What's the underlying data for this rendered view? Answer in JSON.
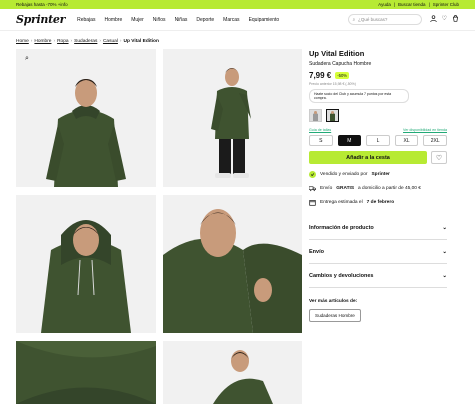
{
  "promo": {
    "left": "Rebajas hasta -70% +info",
    "right": [
      "Ayuda",
      "Buscar tienda",
      "Sprinter Club"
    ]
  },
  "header": {
    "logo": "Sprinter",
    "nav": [
      "Rebajas",
      "Hombre",
      "Mujer",
      "Niños",
      "Niñas",
      "Deporte",
      "Marcas",
      "Equipamiento"
    ],
    "search_placeholder": "¿Qué buscas?"
  },
  "breadcrumb": [
    "Home",
    "Hombre",
    "Ropa",
    "Sudaderas",
    "Casual",
    "Up Vital Edition"
  ],
  "product": {
    "title": "Up Vital Edition",
    "subtitle": "Sudadera Capucha Hombre",
    "price": "7,99 €",
    "discount": "-50%",
    "previous_price": "Precio anterior 15,98 € (-50%)",
    "loyalty": "Hazte socio del Club y acumula 7 puntos por esta compra.",
    "size_guide": "Guía de tallas",
    "availability": "Ver disponibilidad en tienda",
    "sizes": [
      "S",
      "M",
      "L",
      "XL",
      "2XL"
    ],
    "selected_size": "M",
    "add_to_cart": "Añadir a la cesta",
    "seller_prefix": "Vendido y enviado por",
    "seller": "Sprinter",
    "shipping_prefix": "Envío",
    "shipping_bold": "GRATIS",
    "shipping_suffix": "a domicilio a partir de 45,00 €",
    "delivery_prefix": "Entrega estimada el",
    "delivery_date": "7 de febrero",
    "accordion": [
      "Información de producto",
      "Envío",
      "Cambios y devoluciones"
    ],
    "more_label": "Ver más artículos de:",
    "more_chip": "Sudaderas Hombre"
  },
  "colors": {
    "accent": "#b7ea33",
    "hoodie": "#3f5330"
  }
}
